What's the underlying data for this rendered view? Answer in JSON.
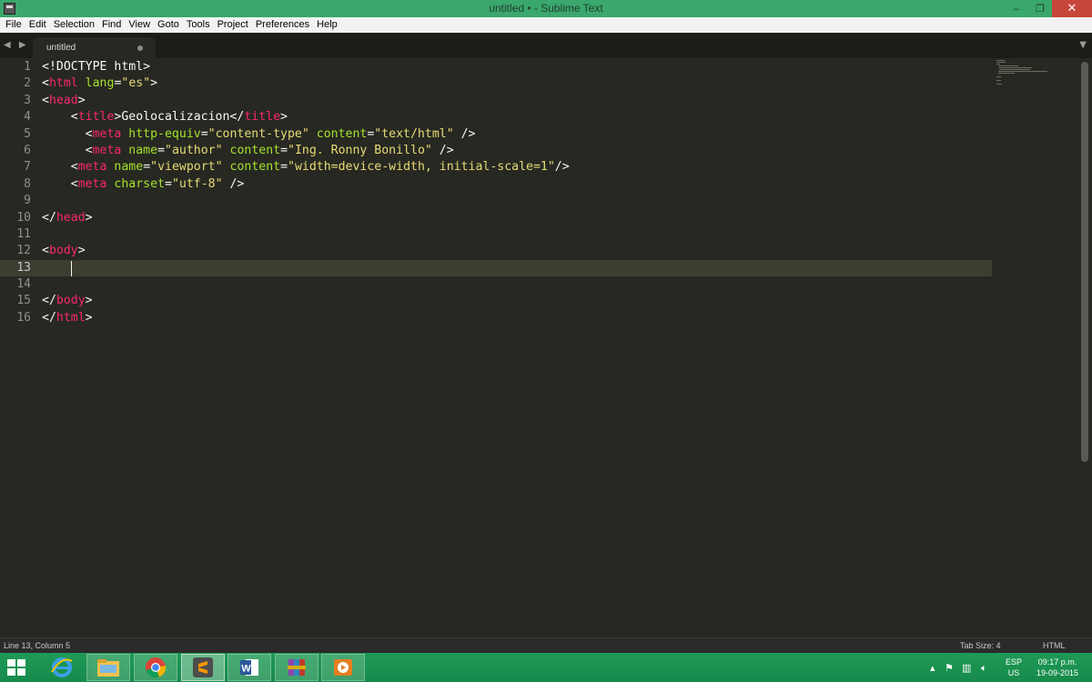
{
  "window": {
    "title": "untitled • - Sublime Text",
    "min": "‒",
    "max": "❐",
    "close": "✕"
  },
  "menu": [
    "File",
    "Edit",
    "Selection",
    "Find",
    "View",
    "Goto",
    "Tools",
    "Project",
    "Preferences",
    "Help"
  ],
  "tab": {
    "label": "untitled",
    "nav": "◀ ▶",
    "dropdown": "▼"
  },
  "editor": {
    "active_line": 13,
    "line_numbers": [
      "1",
      "2",
      "3",
      "4",
      "5",
      "6",
      "7",
      "8",
      "9",
      "10",
      "11",
      "12",
      "13",
      "14",
      "15",
      "16"
    ],
    "lines": [
      [
        {
          "t": "txt",
          "v": "<!DOCTYPE html>"
        }
      ],
      [
        {
          "t": "txt",
          "v": "<"
        },
        {
          "t": "tag",
          "v": "html"
        },
        {
          "t": "txt",
          "v": " "
        },
        {
          "t": "attr",
          "v": "lang"
        },
        {
          "t": "txt",
          "v": "="
        },
        {
          "t": "str",
          "v": "\"es\""
        },
        {
          "t": "txt",
          "v": ">"
        }
      ],
      [
        {
          "t": "txt",
          "v": "<"
        },
        {
          "t": "tag",
          "v": "head"
        },
        {
          "t": "txt",
          "v": ">"
        }
      ],
      [
        {
          "t": "txt",
          "v": "    <"
        },
        {
          "t": "tag",
          "v": "title"
        },
        {
          "t": "txt",
          "v": ">Geolocalizacion</"
        },
        {
          "t": "tag",
          "v": "title"
        },
        {
          "t": "txt",
          "v": ">"
        }
      ],
      [
        {
          "t": "txt",
          "v": "      <"
        },
        {
          "t": "tag",
          "v": "meta"
        },
        {
          "t": "txt",
          "v": " "
        },
        {
          "t": "attr",
          "v": "http-equiv"
        },
        {
          "t": "txt",
          "v": "="
        },
        {
          "t": "str",
          "v": "\"content-type\""
        },
        {
          "t": "txt",
          "v": " "
        },
        {
          "t": "attr",
          "v": "content"
        },
        {
          "t": "txt",
          "v": "="
        },
        {
          "t": "str",
          "v": "\"text/html\""
        },
        {
          "t": "txt",
          "v": " />"
        }
      ],
      [
        {
          "t": "txt",
          "v": "      <"
        },
        {
          "t": "tag",
          "v": "meta"
        },
        {
          "t": "txt",
          "v": " "
        },
        {
          "t": "attr",
          "v": "name"
        },
        {
          "t": "txt",
          "v": "="
        },
        {
          "t": "str",
          "v": "\"author\""
        },
        {
          "t": "txt",
          "v": " "
        },
        {
          "t": "attr",
          "v": "content"
        },
        {
          "t": "txt",
          "v": "="
        },
        {
          "t": "str",
          "v": "\"Ing. Ronny Bonillo\""
        },
        {
          "t": "txt",
          "v": " />"
        }
      ],
      [
        {
          "t": "txt",
          "v": "    <"
        },
        {
          "t": "tag",
          "v": "meta"
        },
        {
          "t": "txt",
          "v": " "
        },
        {
          "t": "attr",
          "v": "name"
        },
        {
          "t": "txt",
          "v": "="
        },
        {
          "t": "str",
          "v": "\"viewport\""
        },
        {
          "t": "txt",
          "v": " "
        },
        {
          "t": "attr",
          "v": "content"
        },
        {
          "t": "txt",
          "v": "="
        },
        {
          "t": "str",
          "v": "\"width=device-width, initial-scale=1\""
        },
        {
          "t": "txt",
          "v": "/>"
        }
      ],
      [
        {
          "t": "txt",
          "v": "    <"
        },
        {
          "t": "tag",
          "v": "meta"
        },
        {
          "t": "txt",
          "v": " "
        },
        {
          "t": "attr",
          "v": "charset"
        },
        {
          "t": "txt",
          "v": "="
        },
        {
          "t": "str",
          "v": "\"utf-8\""
        },
        {
          "t": "txt",
          "v": " />"
        }
      ],
      [],
      [
        {
          "t": "txt",
          "v": "</"
        },
        {
          "t": "tag",
          "v": "head"
        },
        {
          "t": "txt",
          "v": ">"
        }
      ],
      [],
      [
        {
          "t": "txt",
          "v": "<"
        },
        {
          "t": "tag",
          "v": "body"
        },
        {
          "t": "txt",
          "v": ">"
        }
      ],
      [],
      [],
      [
        {
          "t": "txt",
          "v": "</"
        },
        {
          "t": "tag",
          "v": "body"
        },
        {
          "t": "txt",
          "v": ">"
        }
      ],
      [
        {
          "t": "txt",
          "v": "</"
        },
        {
          "t": "tag",
          "v": "html"
        },
        {
          "t": "txt",
          "v": ">"
        }
      ]
    ]
  },
  "status": {
    "position": "Line 13, Column 5",
    "tab_size": "Tab Size: 4",
    "syntax": "HTML"
  },
  "taskbar": {
    "apps": [
      "internet-explorer",
      "file-explorer",
      "chrome",
      "sublime-text",
      "word",
      "winrar",
      "media-player"
    ],
    "language": "ESP",
    "layout": "US",
    "time": "09:17 p.m.",
    "date": "19-09-2015"
  },
  "colors": {
    "titlebar": "#3aa76d",
    "editor_bg": "#272822",
    "tag": "#f92672",
    "attr": "#a6e22e",
    "string": "#e6db74",
    "taskbar": "#1f9a55"
  }
}
